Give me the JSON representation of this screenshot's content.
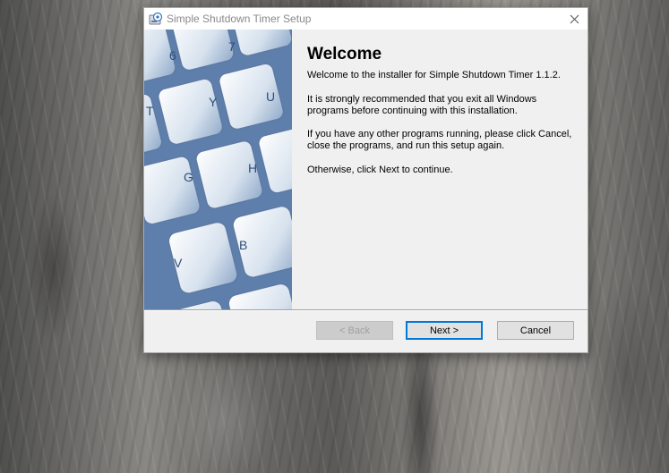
{
  "window": {
    "title": "Simple Shutdown Timer Setup"
  },
  "page": {
    "heading": "Welcome",
    "paragraphs": [
      "Welcome to the installer for Simple Shutdown Timer 1.1.2.",
      "It is strongly recommended that you exit all Windows programs before continuing with this installation.",
      "If you have any other programs running, please click Cancel, close the programs, and run this setup again.",
      "Otherwise, click Next to continue."
    ]
  },
  "banner": {
    "keys": [
      "6",
      "7",
      "T",
      "Y",
      "U",
      "G",
      "H",
      "V",
      "B"
    ]
  },
  "buttons": {
    "back_label": "< Back",
    "next_label": "Next >",
    "cancel_label": "Cancel"
  },
  "icons": {
    "app": "installer-icon",
    "close": "close-icon"
  }
}
